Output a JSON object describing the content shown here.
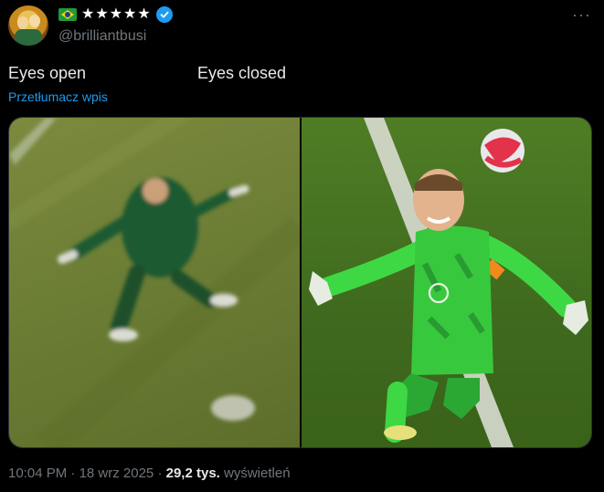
{
  "author": {
    "flag_icon": "brazil-flag-icon",
    "stars": "★★★★★",
    "handle": "@brilliantbusi",
    "verified_icon": "verified-badge-icon",
    "verified_color": "#1d9bf0"
  },
  "post": {
    "text_left": "Eyes open",
    "text_right": "Eyes closed",
    "translate_label": "Przetłumacz wpis",
    "more_label": "···"
  },
  "media": {
    "left_image_icon": "blurry-goalkeeper-photo",
    "right_image_icon": "goalkeeper-celebrating-photo"
  },
  "footer": {
    "time": "10:04 PM",
    "sep1": "·",
    "date": "18 wrz 2025",
    "sep2": "·",
    "views_count": "29,2 tys.",
    "views_label": "wyświetleń"
  },
  "colors": {
    "background": "#000000",
    "text_primary": "#e7e9ea",
    "text_secondary": "#71767b",
    "link": "#1d9bf0"
  }
}
